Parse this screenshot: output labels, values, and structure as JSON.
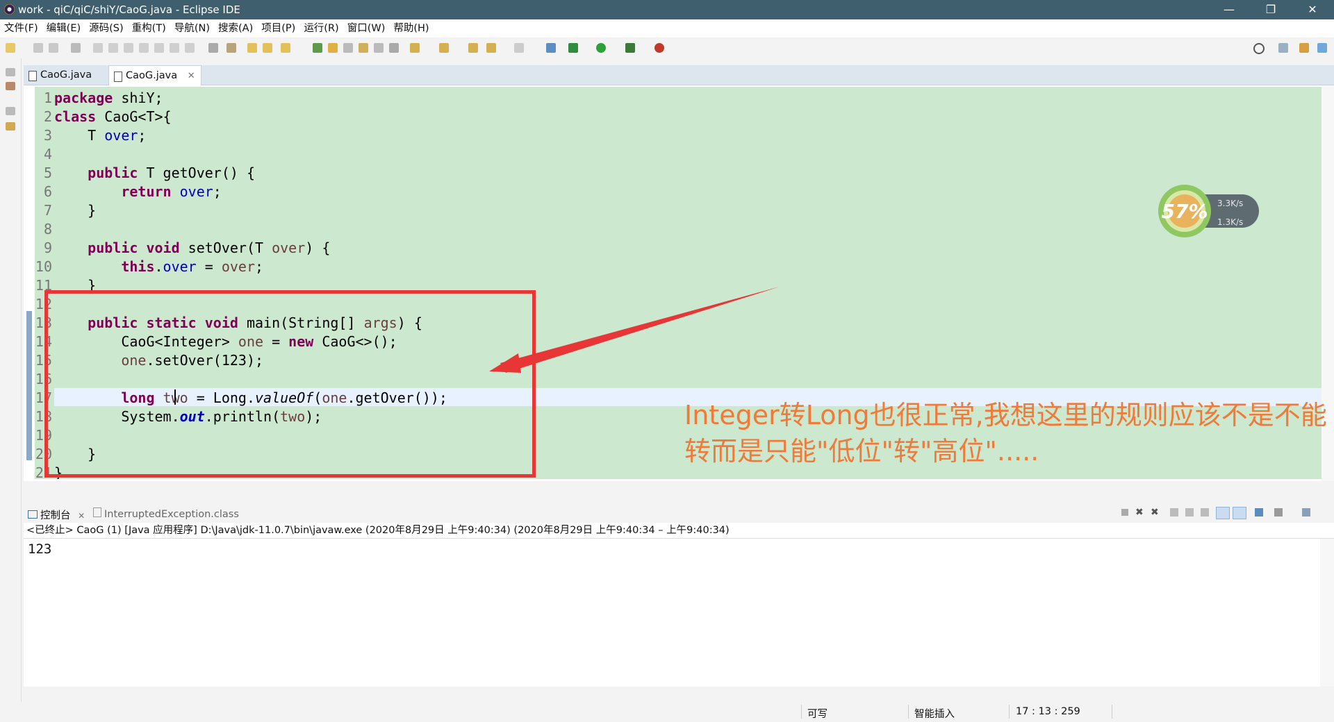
{
  "window": {
    "title": "work - qiC/qiC/shiY/CaoG.java - Eclipse IDE"
  },
  "window_controls": [
    "—",
    "❐",
    "✕"
  ],
  "menu": [
    "文件(F)",
    "编辑(E)",
    "源码(S)",
    "重构(T)",
    "导航(N)",
    "搜索(A)",
    "项目(P)",
    "运行(R)",
    "窗口(W)",
    "帮助(H)"
  ],
  "editor_tabs": [
    {
      "label": "CaoG.java",
      "active": false
    },
    {
      "label": "CaoG.java",
      "active": true,
      "close": "✕"
    }
  ],
  "code": {
    "line_numbers": [
      "1",
      "2",
      "3",
      "4",
      "5",
      "6",
      "7",
      "8",
      "9",
      "10",
      "11",
      "12",
      "13",
      "14",
      "15",
      "16",
      "17",
      "18",
      "19",
      "20",
      "21"
    ],
    "current_line": 17
  },
  "annotation": {
    "text_line1": "Integer转Long也很正常,我想这里的规则应该不是不能",
    "text_line2": "转而是只能\"低位\"转\"高位\".....",
    "color": "#f07a3a",
    "box_color": "#e83535"
  },
  "net_widget": {
    "percent": "57%",
    "up": "3.3K/s",
    "down": "1.3K/s"
  },
  "console": {
    "tabs": [
      {
        "label": "控制台",
        "close": "✕",
        "active": true
      },
      {
        "label": "InterruptedException.class",
        "active": false
      }
    ],
    "header": "<已终止> CaoG (1) [Java 应用程序] D:\\Java\\jdk-11.0.7\\bin\\javaw.exe (2020年8月29日 上午9:40:34) (2020年8月29日 上午9:40:34 – 上午9:40:34)",
    "output": "123"
  },
  "status": {
    "writable": "可写",
    "insert_mode": "智能插入",
    "position": "17 : 13 : 259"
  },
  "colors": {
    "editor_bg": "#cce8cf",
    "title_bar": "#3f5f6f",
    "keyword": "#7f0055",
    "field": "#0000c0"
  }
}
